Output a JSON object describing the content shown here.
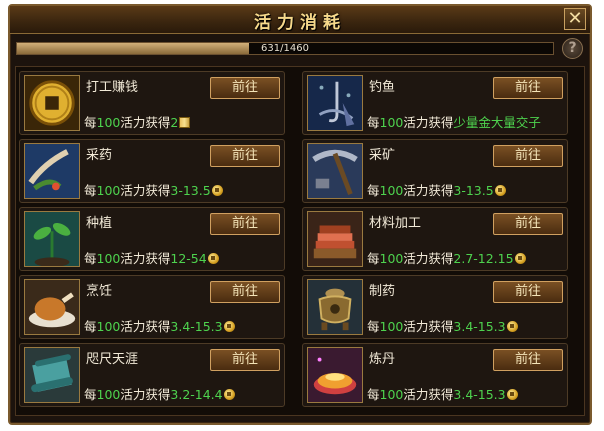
{
  "window": {
    "title": "活力消耗",
    "close_label": "✕"
  },
  "progress": {
    "text": "631/1460",
    "current": 631,
    "max": 1460
  },
  "help_label": "?",
  "go_label": "前往",
  "cards": [
    {
      "name": "打工赚钱",
      "prefix": "每",
      "amount": "100",
      "mid": "活力获得",
      "reward": "2",
      "reward_icon": "book-icon",
      "icon": "copper-coin-icon"
    },
    {
      "name": "钓鱼",
      "prefix": "每",
      "amount": "100",
      "mid": "活力获得",
      "reward": "少量金大量交子",
      "reward_icon": "",
      "icon": "fishing-icon"
    },
    {
      "name": "采药",
      "prefix": "每",
      "amount": "100",
      "mid": "活力获得",
      "reward": "3-13.5",
      "reward_icon": "coin-icon",
      "icon": "herb-gathering-icon"
    },
    {
      "name": "采矿",
      "prefix": "每",
      "amount": "100",
      "mid": "活力获得",
      "reward": "3-13.5",
      "reward_icon": "coin-icon",
      "icon": "pickaxe-icon"
    },
    {
      "name": "种植",
      "prefix": "每",
      "amount": "100",
      "mid": "活力获得",
      "reward": "12-54",
      "reward_icon": "coin-icon",
      "icon": "sprout-icon"
    },
    {
      "name": "材料加工",
      "prefix": "每",
      "amount": "100",
      "mid": "活力获得",
      "reward": "2.7-12.15",
      "reward_icon": "coin-icon",
      "icon": "material-stack-icon"
    },
    {
      "name": "烹饪",
      "prefix": "每",
      "amount": "100",
      "mid": "活力获得",
      "reward": "3.4-15.3",
      "reward_icon": "coin-icon",
      "icon": "roast-chicken-icon"
    },
    {
      "name": "制药",
      "prefix": "每",
      "amount": "100",
      "mid": "活力获得",
      "reward": "3.4-15.3",
      "reward_icon": "coin-icon",
      "icon": "censer-icon"
    },
    {
      "name": "咫尺天涯",
      "prefix": "每",
      "amount": "100",
      "mid": "活力获得",
      "reward": "3.2-14.4",
      "reward_icon": "coin-icon",
      "icon": "scroll-icon"
    },
    {
      "name": "炼丹",
      "prefix": "每",
      "amount": "100",
      "mid": "活力获得",
      "reward": "3.4-15.3",
      "reward_icon": "coin-icon",
      "icon": "alchemy-furnace-icon"
    }
  ],
  "colors": {
    "highlight": "#4ed24e",
    "gold_text": "#f6d98b",
    "panel_bg": "#1c130d"
  }
}
